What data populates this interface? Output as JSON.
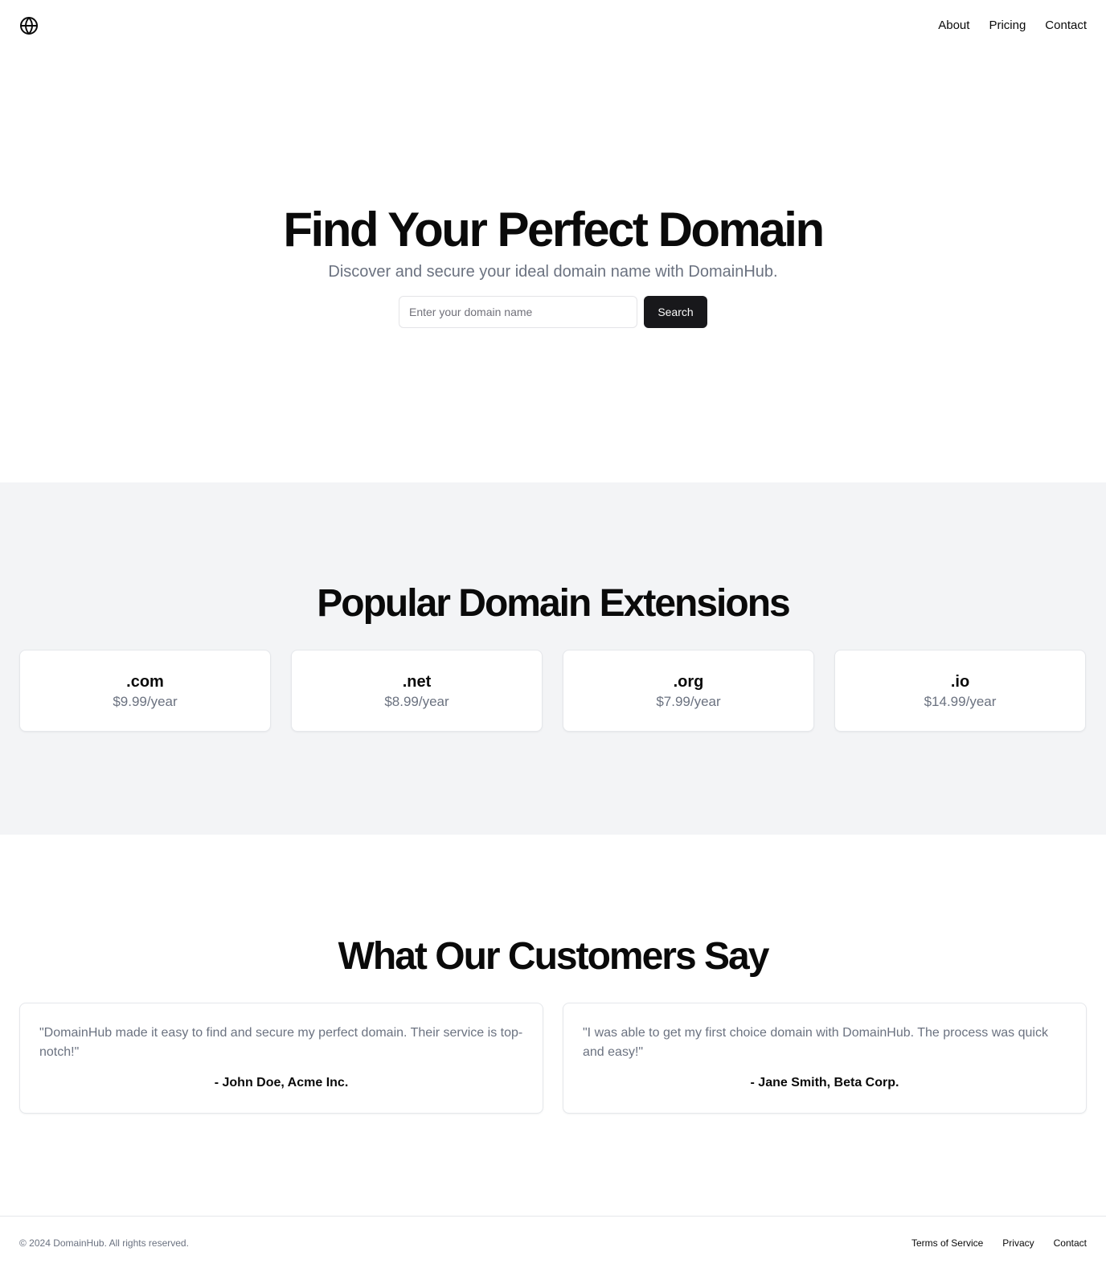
{
  "header": {
    "logo_icon": "globe-icon",
    "nav": [
      {
        "label": "About"
      },
      {
        "label": "Pricing"
      },
      {
        "label": "Contact"
      }
    ]
  },
  "hero": {
    "title": "Find Your Perfect Domain",
    "subtitle": "Discover and secure your ideal domain name with DomainHub.",
    "search": {
      "placeholder": "Enter your domain name",
      "value": "",
      "button_label": "Search"
    }
  },
  "extensions": {
    "title": "Popular Domain Extensions",
    "items": [
      {
        "name": ".com",
        "price": "$9.99/year"
      },
      {
        "name": ".net",
        "price": "$8.99/year"
      },
      {
        "name": ".org",
        "price": "$7.99/year"
      },
      {
        "name": ".io",
        "price": "$14.99/year"
      }
    ]
  },
  "testimonials": {
    "title": "What Our Customers Say",
    "items": [
      {
        "quote": "\"DomainHub made it easy to find and secure my perfect domain. Their service is top-notch!\"",
        "author": "- John Doe, Acme Inc."
      },
      {
        "quote": "\"I was able to get my first choice domain with DomainHub. The process was quick and easy!\"",
        "author": "- Jane Smith, Beta Corp."
      }
    ]
  },
  "footer": {
    "copyright": "© 2024 DomainHub. All rights reserved.",
    "links": [
      {
        "label": "Terms of Service"
      },
      {
        "label": "Privacy"
      },
      {
        "label": "Contact"
      }
    ]
  },
  "colors": {
    "primary_button": "#18181b",
    "muted_text": "#6b7280",
    "section_bg": "#f3f4f6",
    "border": "#e5e7eb"
  }
}
